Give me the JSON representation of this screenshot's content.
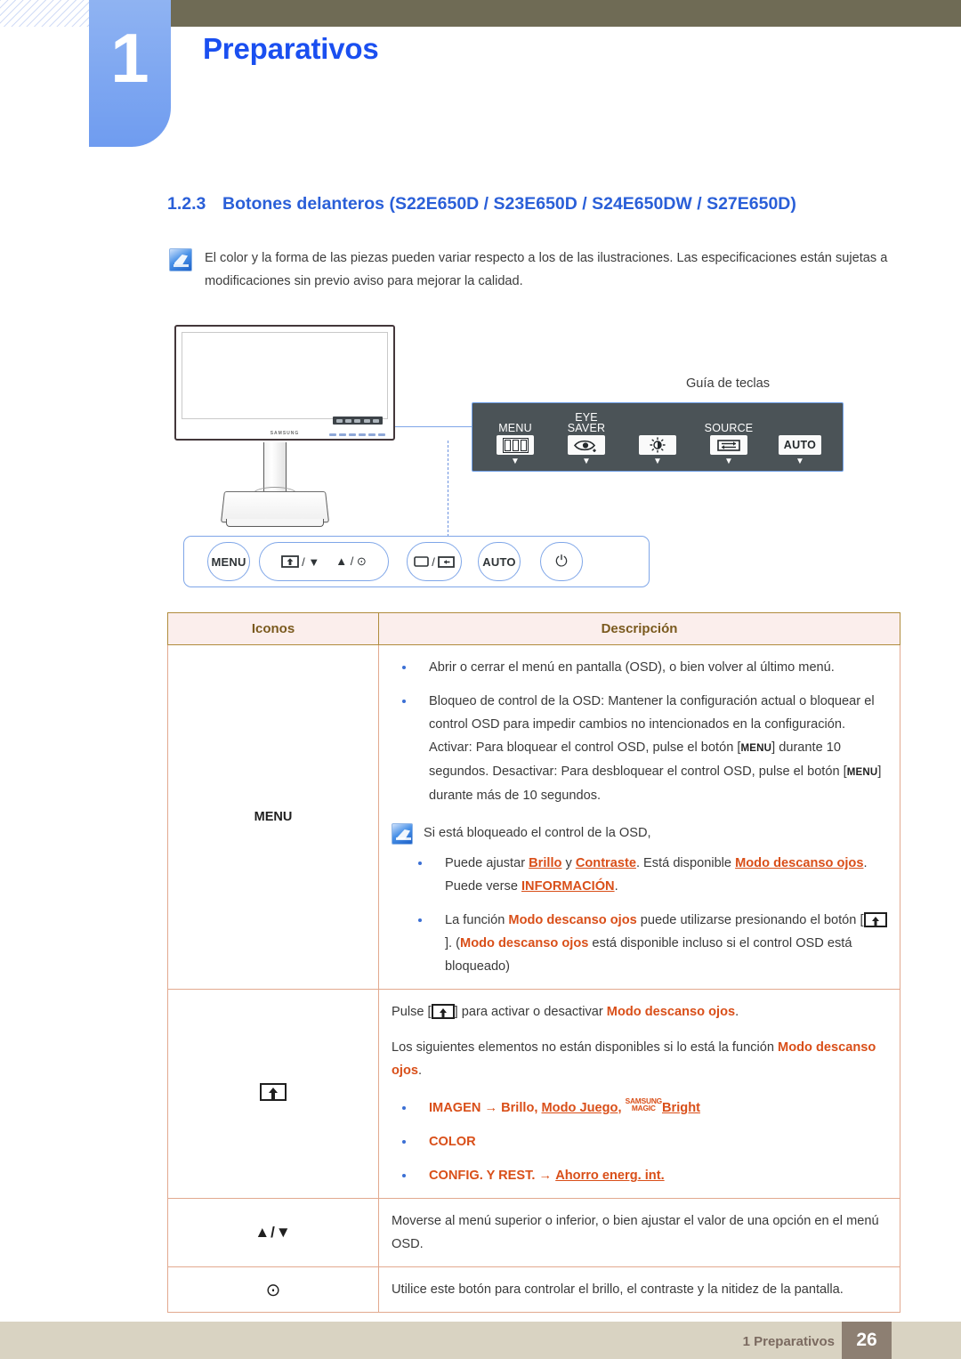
{
  "chapter": {
    "number": "1",
    "title": "Preparativos"
  },
  "section": {
    "number": "1.2.3",
    "title": "Botones delanteros (S22E650D / S23E650D / S24E650DW / S27E650D)"
  },
  "top_note": {
    "icon": "note-pen-icon",
    "text": "El color y la forma de las piezas pueden variar respecto a los de las ilustraciones. Las especificaciones están sujetas a modificaciones sin previo aviso para mejorar la calidad."
  },
  "illustration": {
    "monitor_brand": "SAMSUNG",
    "key_guide_title": "Guía de teclas",
    "key_guide_items": [
      {
        "label_line1": "",
        "label_line2": "MENU",
        "icon": "menu-bars-icon",
        "caret": "▼"
      },
      {
        "label_line1": "EYE",
        "label_line2": "SAVER",
        "icon": "eye-saver-icon",
        "caret": "▼"
      },
      {
        "label_line1": "",
        "label_line2": "",
        "icon": "brightness-icon",
        "caret": "▼"
      },
      {
        "label_line1": "",
        "label_line2": "SOURCE",
        "icon": "source-loop-icon",
        "caret": "▼"
      },
      {
        "label_line1": "",
        "label_line2": "",
        "icon": "auto-icon",
        "icon_text": "AUTO",
        "caret": "▼"
      }
    ],
    "button_bar": [
      {
        "name": "menu-button",
        "text": "MENU"
      },
      {
        "name": "eyesaver-down-button",
        "text": "/ ▼",
        "icon": "screen-up-arrow-icon"
      },
      {
        "name": "up-brightness-button",
        "text": "▲ / ⊙"
      },
      {
        "name": "source-return-button",
        "text": "/",
        "icon": "source-icon"
      },
      {
        "name": "auto-button",
        "text": "AUTO"
      },
      {
        "name": "power-button",
        "text": "⏻"
      }
    ]
  },
  "table": {
    "headers": [
      "Iconos",
      "Descripción"
    ],
    "rows": [
      {
        "icon_label": "MENU",
        "icon_kind": "text",
        "bullets": [
          "Abrir o cerrar el menú en pantalla (OSD), o bien volver al último menú.",
          "Bloqueo de control de la OSD: Mantener la configuración actual o bloquear el control OSD para impedir cambios no intencionados en la configuración. Activar: Para bloquear el control OSD, pulse el botón [MENU] durante 10 segundos. Desactivar: Para desbloquear el control OSD, pulse el botón [MENU] durante más de 10 segundos."
        ],
        "inner_note": {
          "lead": "Si está bloqueado el control de la OSD,",
          "items": [
            "Puede ajustar Brillo y Contraste. Está disponible Modo descanso ojos. Puede verse INFORMACIÓN.",
            "La función Modo descanso ojos puede utilizarse presionando el botón [ ]. (Modo descanso ojos está disponible incluso si el control OSD está bloqueado)"
          ]
        }
      },
      {
        "icon_label": "",
        "icon_kind": "eye-saver-box-icon",
        "para1": "Pulse [ ] para activar o desactivar Modo descanso ojos.",
        "para2": "Los siguientes elementos no están disponibles si lo está la función Modo descanso ojos.",
        "bullets_red": [
          "IMAGEN → Brillo, Modo Juego, SAMSUNG MAGIC Bright",
          "COLOR",
          "CONFIG. Y REST. → Ahorro energ. int."
        ]
      },
      {
        "icon_label": "▲/▼",
        "icon_kind": "arrows",
        "text": "Moverse al menú superior o inferior, o bien ajustar el valor de una opción en el menú OSD."
      },
      {
        "icon_label": "⊙",
        "icon_kind": "target",
        "text": "Utilice este botón para controlar el brillo, el contraste y la nitidez de la pantalla."
      }
    ]
  },
  "footer": {
    "text": "1 Preparativos",
    "page": "26"
  },
  "colors": {
    "chapter_blue": "#1a4ff0",
    "tab_blue": "#6f9cf0",
    "olive_band": "#6f6b55",
    "heading_blue": "#2a5fd8",
    "table_header_bg": "#fbeeec",
    "table_header_text": "#7a5a1e",
    "table_border": "#e2a98f",
    "accent_red": "#d94f19",
    "footer_band": "#d9d3c2",
    "footer_page_bg": "#8d7f72",
    "key_guide_panel": "#4b5357"
  }
}
